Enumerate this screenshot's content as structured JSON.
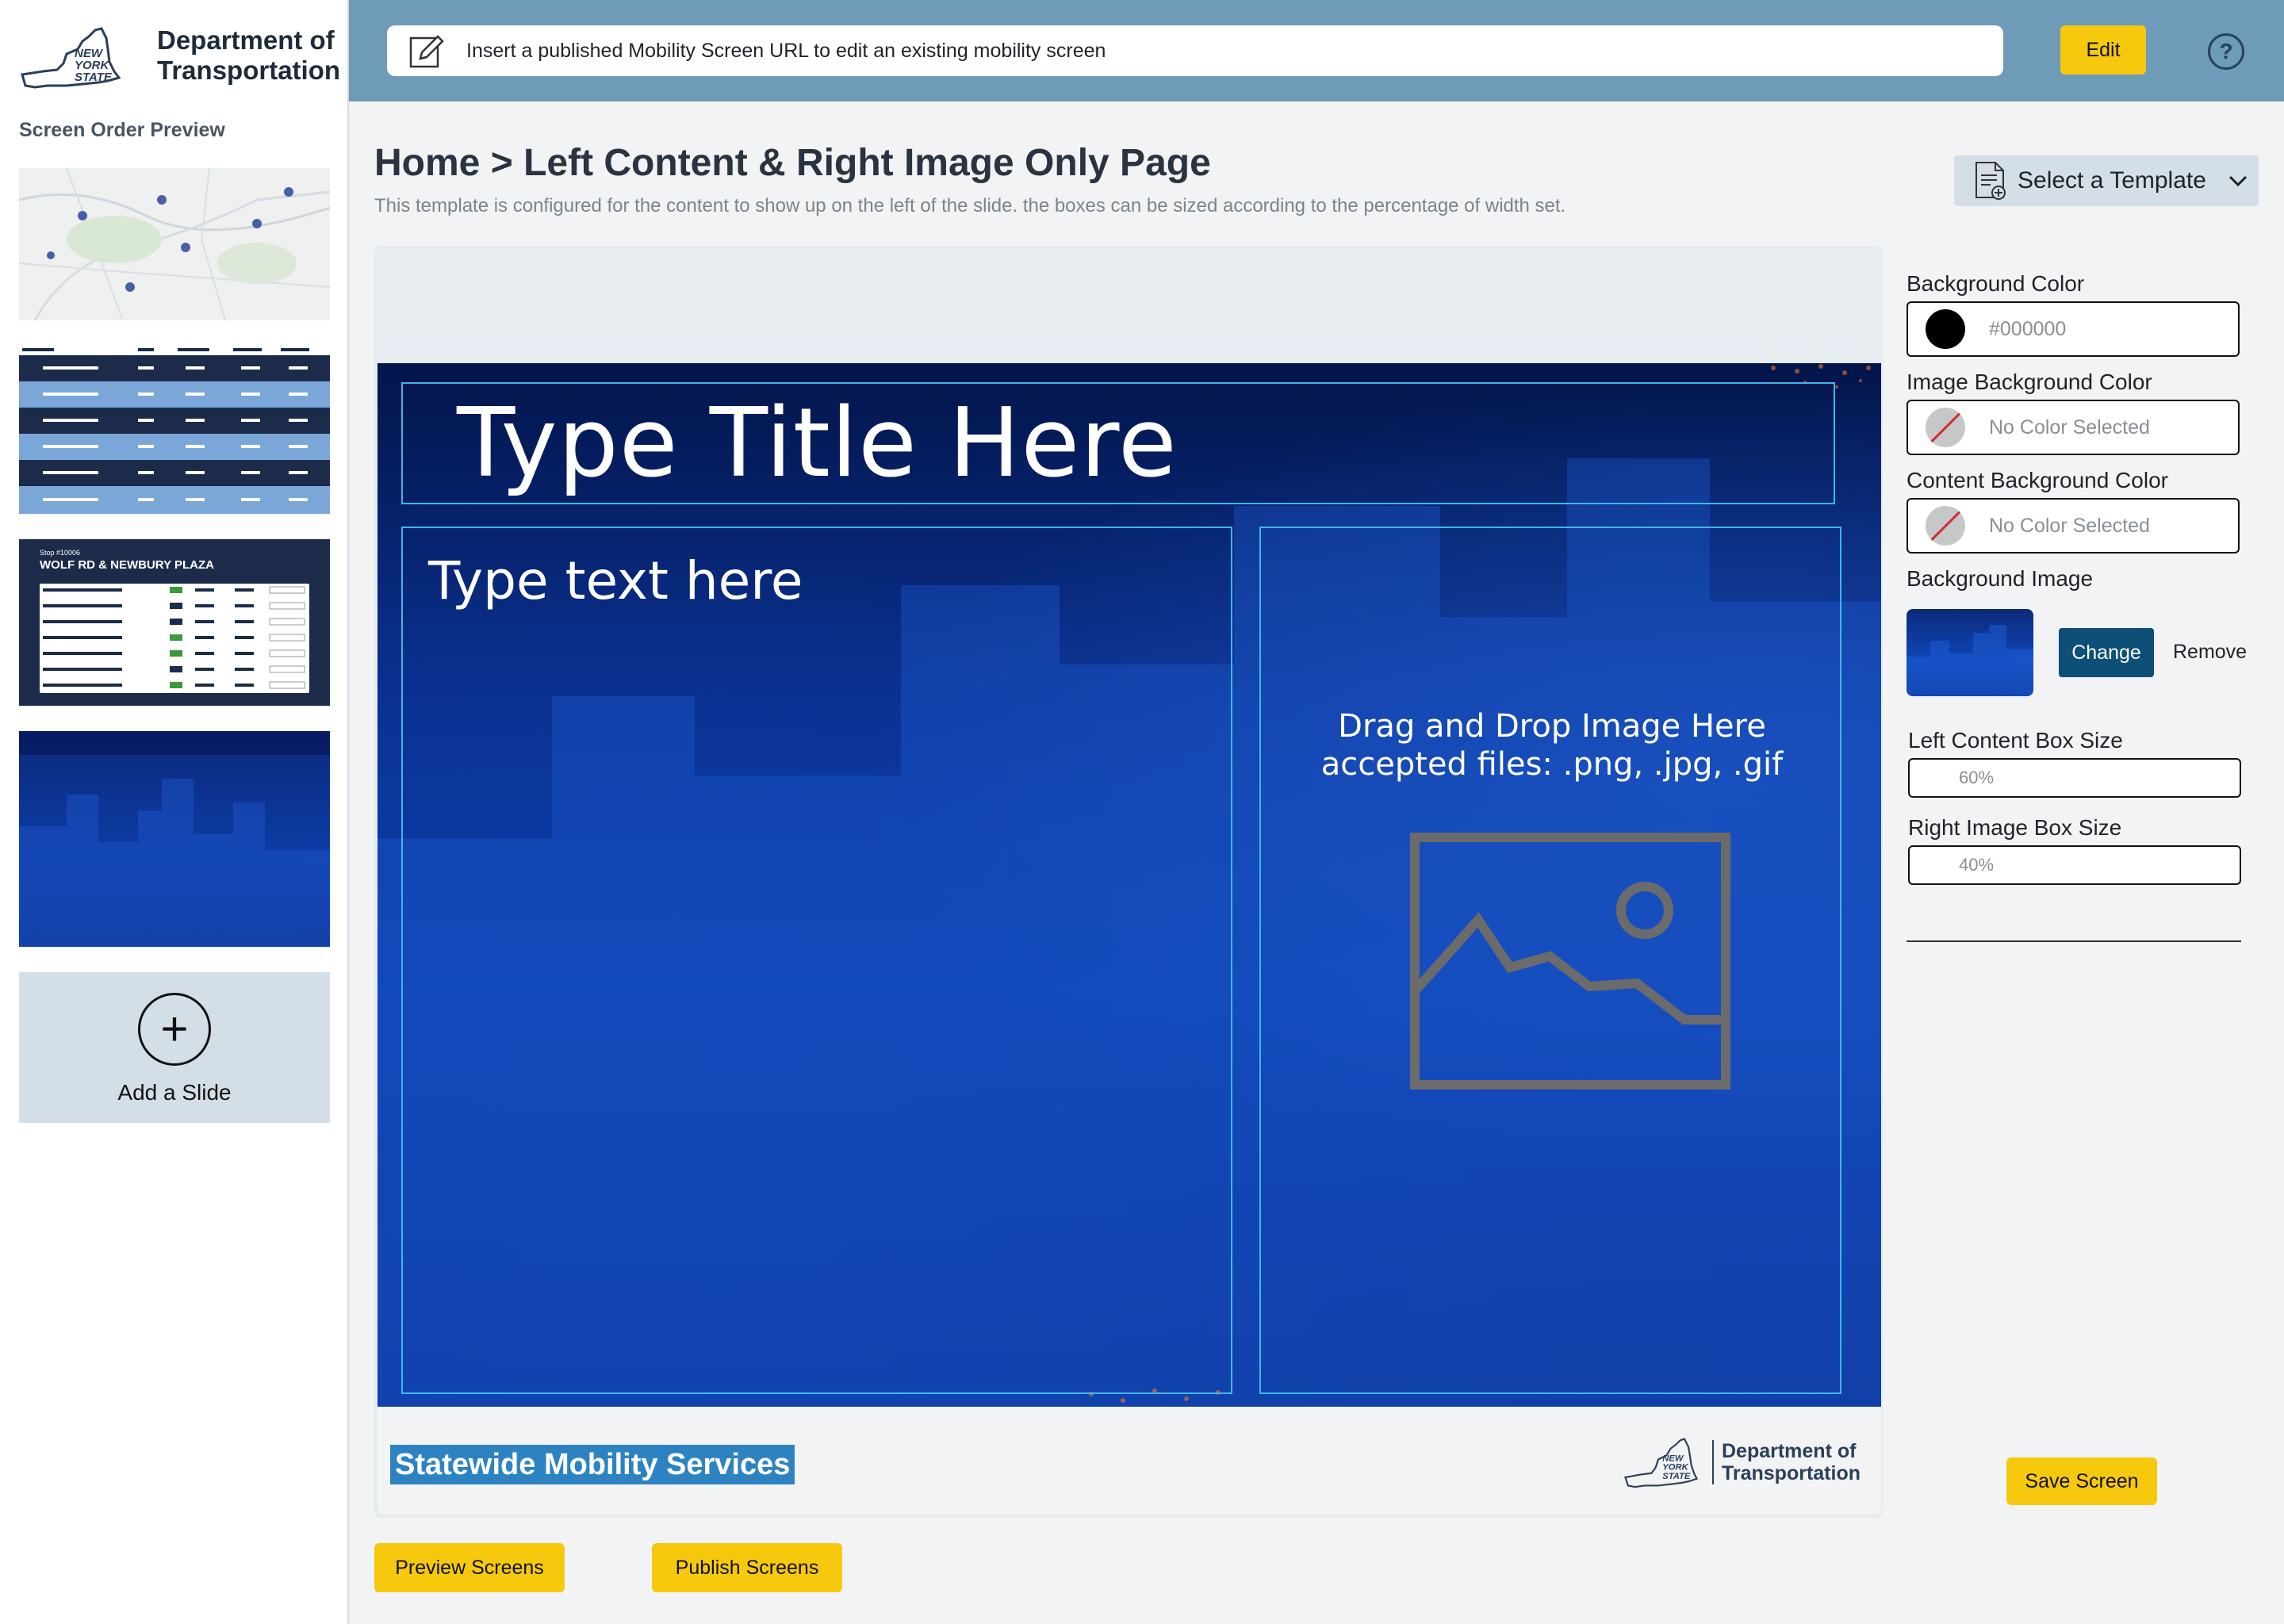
{
  "sidebar": {
    "logo_state": "NEW YORK STATE",
    "logo_text_line1": "Department of",
    "logo_text_line2": "Transportation",
    "title": "Screen Order Preview",
    "add_slide_label": "Add a Slide",
    "thumb3": {
      "stop_label": "Stop #10006",
      "stop_name": "WOLF RD & NEWBURY PLAZA"
    }
  },
  "topbar": {
    "url_placeholder": "Insert a published Mobility Screen URL to edit an existing mobility screen",
    "edit_label": "Edit",
    "help_label": "?"
  },
  "header": {
    "title": "Home > Left Content & Right Image Only Page",
    "description": "This template is configured for the content to show up on the left of the slide.  the boxes can be sized according to the percentage of width set.",
    "template_select": "Select a Template"
  },
  "slide": {
    "title_placeholder": "Type Title Here",
    "content_placeholder": "Type text here",
    "drop_line1": "Drag and Drop Image Here",
    "drop_line2": "accepted files: .png, .jpg, .gif",
    "footer_badge": "Statewide Mobility Services",
    "footer_logo_state": "NEW YORK STATE",
    "footer_logo_line1": "Department of",
    "footer_logo_line2": "Transportation"
  },
  "actions": {
    "preview": "Preview Screens",
    "publish": "Publish Screens",
    "save": "Save Screen"
  },
  "panel": {
    "background_color_label": "Background Color",
    "background_color_value": "#000000",
    "image_bg_label": "Image Background Color",
    "image_bg_value": "No Color Selected",
    "content_bg_label": "Content Background Color",
    "content_bg_value": "No Color Selected",
    "bg_image_label": "Background Image",
    "change_label": "Change",
    "remove_label": "Remove",
    "left_size_label": "Left Content Box Size",
    "left_size_value": "60%",
    "right_size_label": "Right Image Box Size",
    "right_size_value": "40%"
  },
  "colors": {
    "topbar": "#6d9bb8",
    "accent_yellow": "#f6c90e",
    "button_blue": "#0e4f78",
    "box_outline": "#3fb6e6"
  }
}
